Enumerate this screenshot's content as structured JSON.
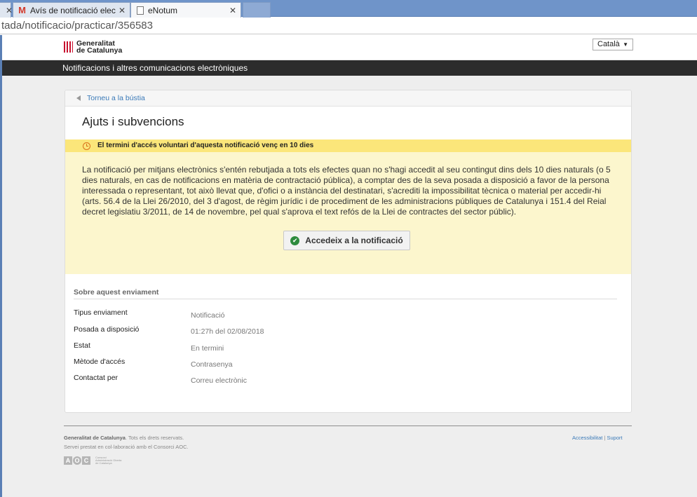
{
  "browser": {
    "tabs": [
      {
        "label": "Avís de notificació electròn"
      },
      {
        "label": "eNotum"
      }
    ],
    "url": "tada/notificacio/practicar/356583"
  },
  "header": {
    "logo_line1": "Generalitat",
    "logo_line2": "de Catalunya",
    "language": "Català",
    "nav_title": "Notificacions i altres comunicacions electròniques"
  },
  "card": {
    "back_link": "Torneu a la bústia",
    "title": "Ajuts i subvencions",
    "deadline": "El termini d'accés voluntari d'aquesta notificació venç en 10 dies",
    "notice": "La notificació per mitjans electrònics s'entén rebutjada a tots els efectes quan no s'hagi accedit al seu contingut dins dels 10 dies naturals (o 5 dies naturals, en cas de notificacions en matèria de contractació pública), a comptar des de la seva posada a disposició a favor de la persona interessada o representant, tot això llevat que, d'ofici o a instància del destinatari, s'acrediti la impossibilitat tècnica o material per accedir-hi (arts. 56.4 de la Llei 26/2010, del 3 d'agost, de règim jurídic i de procediment de les administracions públiques de Catalunya i 151.4 del Reial decret legislatiu 3/2011, de 14 de novembre, pel qual s'aprova el text refós de la Llei de contractes del sector públic).",
    "access_button": "Accedeix a la notificació",
    "section_title": "Sobre aquest enviament",
    "details": [
      {
        "label": "Tipus enviament",
        "value": "Notificació"
      },
      {
        "label": "Posada a disposició",
        "value": "01:27h del 02/08/2018"
      },
      {
        "label": "Estat",
        "value": "En termini"
      },
      {
        "label": "Mètode d'accés",
        "value": "Contrasenya"
      },
      {
        "label": "Contactat per",
        "value": "Correu electrònic"
      }
    ]
  },
  "footer": {
    "org": "Generalitat de Catalunya",
    "rights": ". Tots els drets reservats.",
    "service": "Servei prestat en col·laboració amb el Consorci AOC.",
    "accessibility": "Accessibilitat",
    "separator": "|",
    "support": "Suport",
    "aoc_letters": [
      "A",
      "O",
      "C"
    ],
    "aoc_caption": "Consorci Administració Oberta de Catalunya"
  },
  "colors": {
    "nav_bg": "#2c2c2c",
    "deadline_bg": "#fbe67a",
    "notice_bg": "#fcf6cd",
    "link": "#3b7ab8",
    "brand_red": "#c8102e",
    "check_green": "#2e8b3e"
  },
  "icons": [
    "gmail-icon",
    "document-icon",
    "close-icon",
    "back-arrow-icon",
    "clock-icon",
    "check-circle-icon",
    "dropdown-arrow-icon"
  ]
}
